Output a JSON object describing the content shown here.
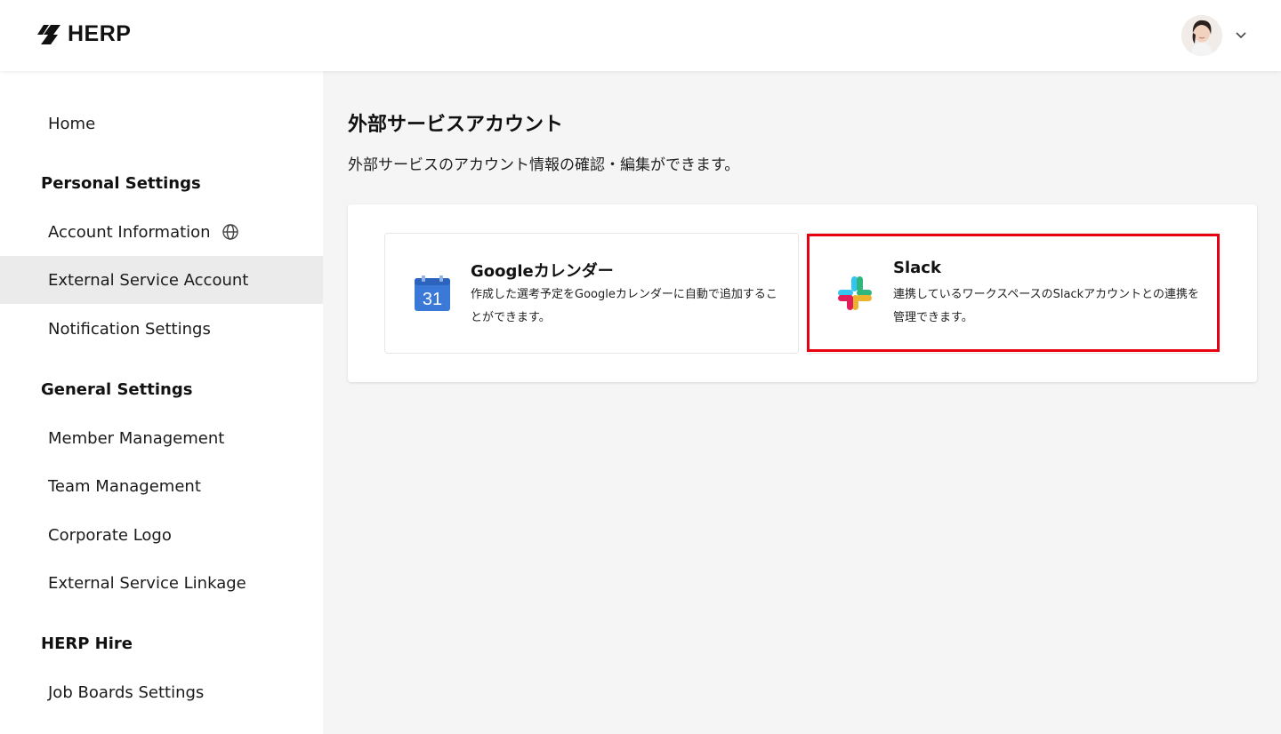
{
  "app": {
    "logo_text": "HERP"
  },
  "header": {
    "user_avatar": "user-avatar",
    "menu_icon": "chevron-down-icon"
  },
  "sidebar": {
    "home": "Home",
    "sections": [
      {
        "title": "Personal Settings",
        "items": [
          "Account Information",
          "External Service Account",
          "Notification Settings"
        ]
      },
      {
        "title": "General Settings",
        "items": [
          "Member Management",
          "Team Management",
          "Corporate Logo",
          "External Service Linkage"
        ]
      },
      {
        "title": "HERP Hire",
        "items": [
          "Job Boards Settings"
        ]
      }
    ],
    "active_item": "External Service Account"
  },
  "main": {
    "title": "外部サービスアカウント",
    "description": "外部サービスのアカウント情報の確認・編集ができます。",
    "services": [
      {
        "name": "Googleカレンダー",
        "description": "作成した選考予定をGoogleカレンダーに自動で追加することができます。",
        "icon": "google-calendar-icon",
        "icon_text": "31"
      },
      {
        "name": "Slack",
        "description": "連携しているワークスペースのSlackアカウントとの連携を管理できます。",
        "icon": "slack-icon"
      }
    ]
  },
  "colors": {
    "highlight": "#e60012",
    "active_bg": "#ebebeb",
    "page_bg": "#f5f5f5"
  }
}
